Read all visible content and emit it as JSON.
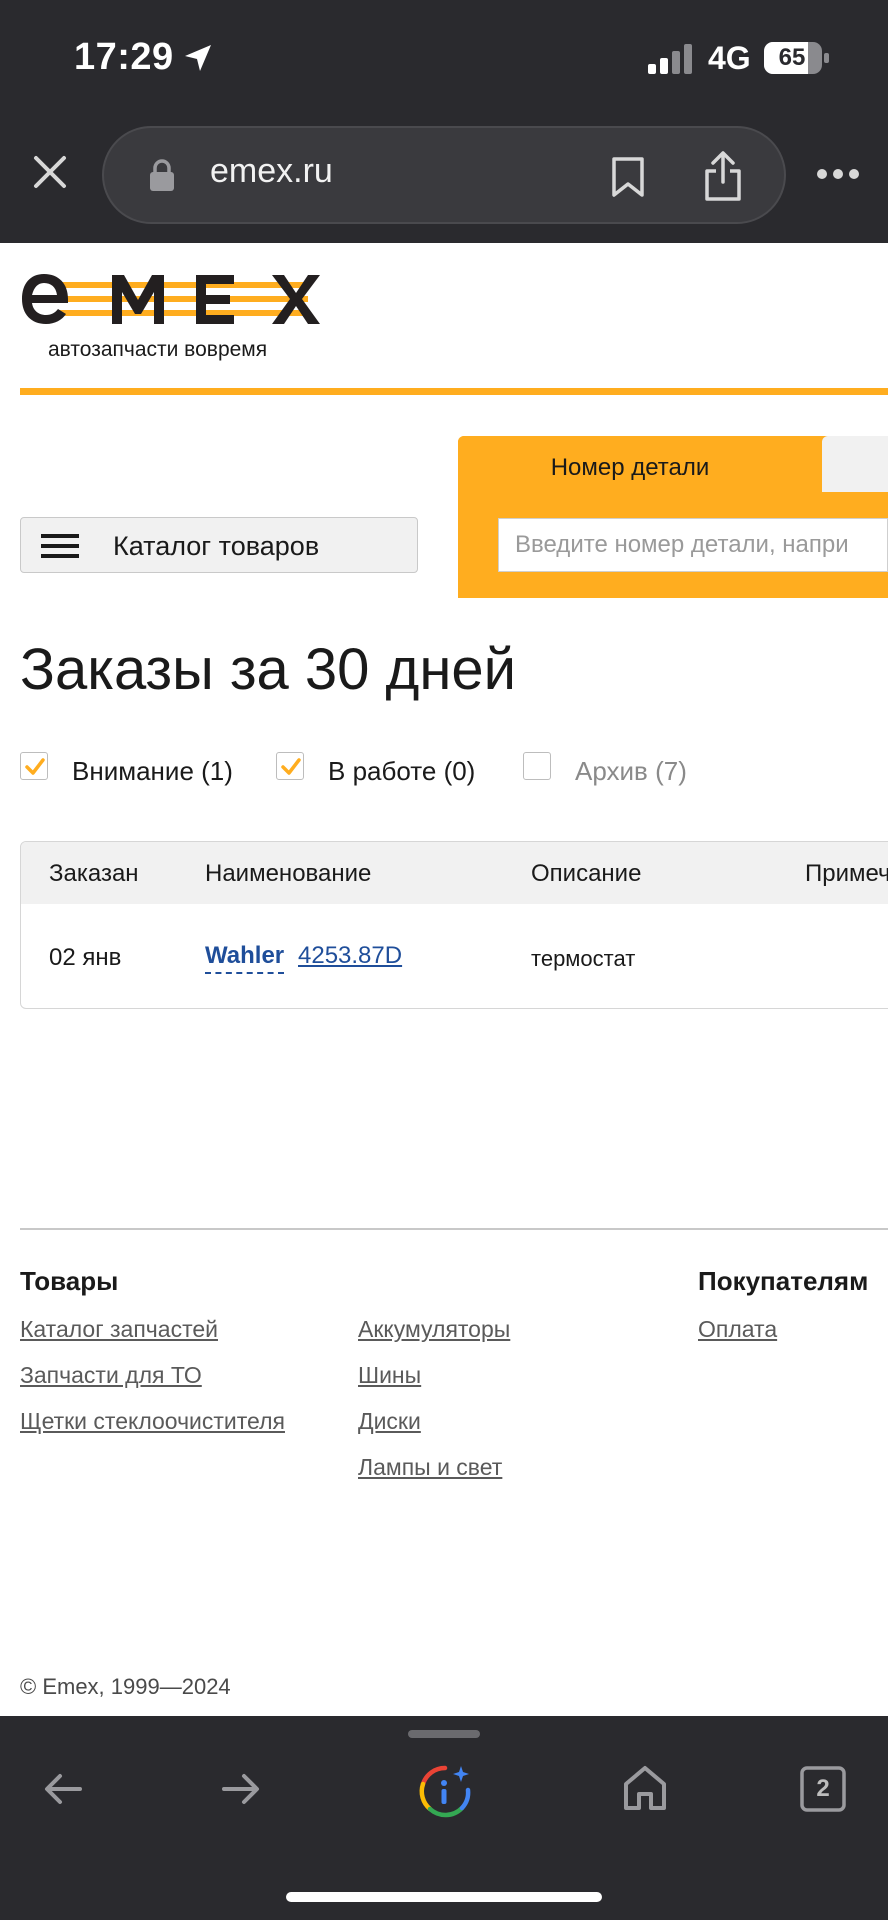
{
  "status_bar": {
    "time": "17:29",
    "network": "4G",
    "battery": "65"
  },
  "browser": {
    "url": "emex.ru",
    "tab_count": "2"
  },
  "header": {
    "tagline": "автозапчасти вовремя",
    "catalog_button": "Каталог товаров"
  },
  "search": {
    "active_tab": "Номер детали",
    "placeholder": "Введите номер детали, напри"
  },
  "page": {
    "title": "Заказы за 30 дней"
  },
  "filters": [
    {
      "label": "Внимание (1)",
      "checked": true
    },
    {
      "label": "В работе (0)",
      "checked": true
    },
    {
      "label": "Архив (7)",
      "checked": false
    }
  ],
  "table": {
    "columns": [
      "Заказан",
      "Наименование",
      "Описание",
      "Примеч"
    ],
    "rows": [
      {
        "ordered": "02 янв",
        "brand": "Wahler",
        "part_number": "4253.87D",
        "description": "термостат"
      }
    ]
  },
  "footer": {
    "goods_heading": "Товары",
    "buyers_heading": "Покупателям",
    "col1": [
      "Каталог запчастей",
      "Запчасти для ТО",
      "Щетки стеклоочистителя"
    ],
    "col2": [
      "Аккумуляторы",
      "Шины",
      "Диски",
      "Лампы и свет"
    ],
    "col3": [
      "Оплата"
    ],
    "copyright": "© Emex, 1999—2024"
  },
  "colors": {
    "accent": "#ffad1f",
    "link": "#1f4e9a",
    "chrome": "#2a2a2e"
  },
  "icons": [
    "location-arrow-icon",
    "signal-icon",
    "battery-icon",
    "close-icon",
    "lock-icon",
    "bookmark-icon",
    "share-icon",
    "more-icon",
    "menu-icon",
    "checkmark-icon",
    "back-icon",
    "forward-icon",
    "assistant-icon",
    "home-icon",
    "tabs-icon"
  ]
}
